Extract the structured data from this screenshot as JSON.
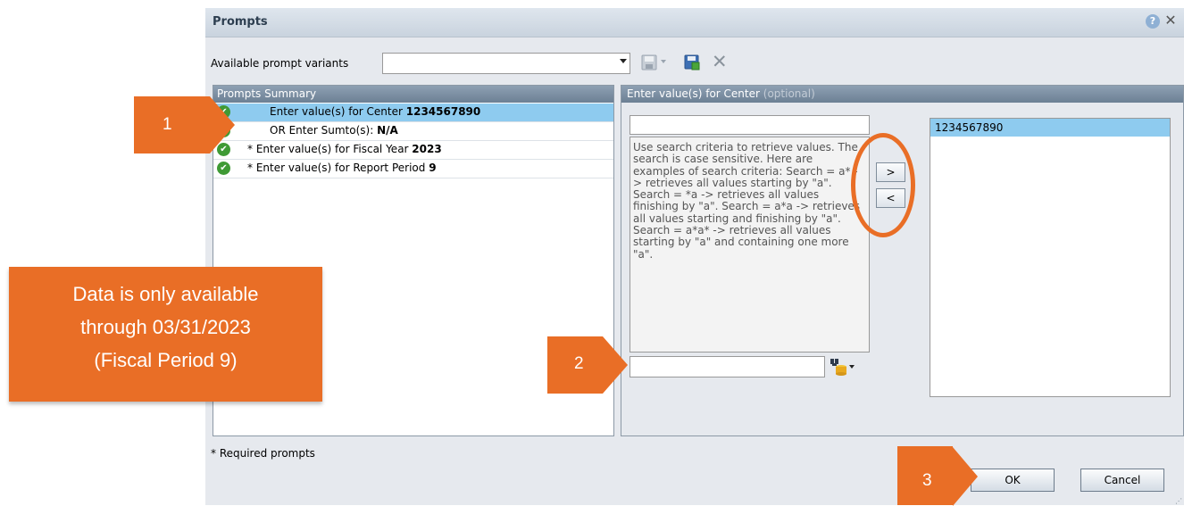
{
  "dialog": {
    "title": "Prompts",
    "help_icon": "help-icon",
    "close_icon": "close-icon",
    "variants_label": "Available prompt variants",
    "variants_value": "",
    "required_note": "* Required prompts",
    "ok_label": "OK",
    "cancel_label": "Cancel"
  },
  "summary": {
    "header": "Prompts Summary",
    "rows": [
      {
        "text": "Enter value(s) for Center ",
        "value": "1234567890",
        "selected": true
      },
      {
        "text": "OR Enter Sumto(s): ",
        "value": "N/A",
        "selected": false
      },
      {
        "text": "* Enter value(s) for Fiscal Year ",
        "value": "2023",
        "selected": false
      },
      {
        "text": "* Enter value(s) for Report Period ",
        "value": "9",
        "selected": false
      }
    ]
  },
  "value_panel": {
    "header": "Enter value(s) for Center",
    "header_optional": "(optional)",
    "help_text": "Use search criteria to retrieve values. The search is case sensitive. Here are examples of search criteria: Search = a* -> retrieves all values starting by \"a\". Search = *a -> retrieves all values finishing by \"a\". Search = a*a -> retrieves all values starting and finishing by \"a\". Search = a*a* -> retrieves all values starting by \"a\" and containing one more \"a\".",
    "add_label": ">",
    "remove_label": "<",
    "search_value": "",
    "selected_values": [
      "1234567890"
    ]
  },
  "callouts": {
    "step1": "1",
    "step2": "2",
    "step3": "3",
    "note_line1": "Data is only available",
    "note_line2": "through 03/31/2023",
    "note_line3": "(Fiscal Period 9)"
  },
  "colors": {
    "callout": "#e96e26",
    "header": "#7b8ea2",
    "selection": "#8ecbef",
    "check": "#3f9a35"
  }
}
